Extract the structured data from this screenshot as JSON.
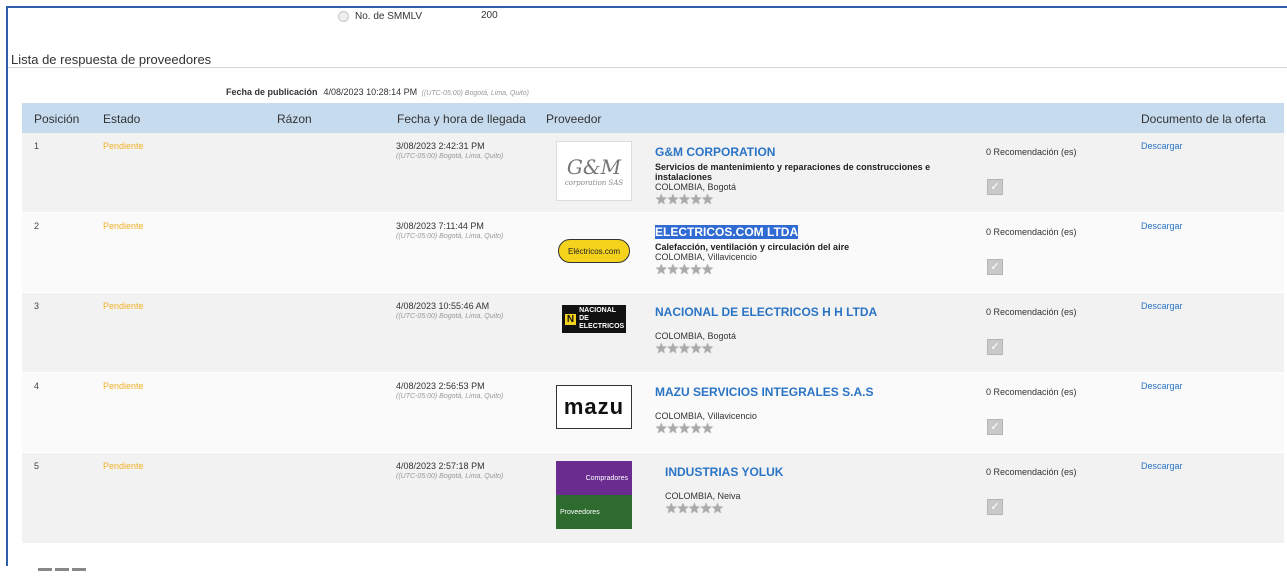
{
  "header": {
    "smmlv_label": "No. de SMMLV",
    "smmlv_value": "200",
    "section_title": "Lista de respuesta de proveedores",
    "pub_label": "Fecha de publicación",
    "pub_date": "4/08/2023 10:28:14 PM",
    "pub_tz": "((UTC-05:00) Bogotá, Lima, Quito)"
  },
  "columns": {
    "posicion": "Posición",
    "estado": "Estado",
    "razon": "Rázon",
    "fecha": "Fecha y hora de llegada",
    "proveedor": "Proveedor",
    "documento": "Documento de la oferta"
  },
  "rows": [
    {
      "pos": "1",
      "estado": "Pendiente",
      "fecha": "3/08/2023 2:42:31 PM",
      "tz": "((UTC-05:00) Bogotá, Lima, Quito)",
      "name": "G&M CORPORATION",
      "desc": "Servicios de mantenimiento y reparaciones de construcciones e instalaciones",
      "loc": "COLOMBIA, Bogotá",
      "rec": "0 Recomendación (es)",
      "download": "Descargar",
      "logo_text": "G&M",
      "logo_sub": "corporation SAS"
    },
    {
      "pos": "2",
      "estado": "Pendiente",
      "fecha": "3/08/2023 7:11:44 PM",
      "tz": "((UTC-05:00) Bogotá, Lima, Quito)",
      "name": "ELECTRICOS.COM LTDA",
      "desc": "Calefacción, ventilación y circulación del aire",
      "loc": "COLOMBIA, Villavicencio",
      "rec": "0 Recomendación (es)",
      "download": "Descargar",
      "logo_text": "Eléctricos.com"
    },
    {
      "pos": "3",
      "estado": "Pendiente",
      "fecha": "4/08/2023 10:55:46 AM",
      "tz": "((UTC-05:00) Bogotá, Lima, Quito)",
      "name": "NACIONAL DE ELECTRICOS H H LTDA",
      "desc": "",
      "loc": "COLOMBIA, Bogotá",
      "rec": "0 Recomendación (es)",
      "download": "Descargar",
      "logo_text": "NACIONAL DE ELECTRICOS"
    },
    {
      "pos": "4",
      "estado": "Pendiente",
      "fecha": "4/08/2023 2:56:53 PM",
      "tz": "((UTC-05:00) Bogotá, Lima, Quito)",
      "name": "MAZU SERVICIOS INTEGRALES S.A.S",
      "desc": "",
      "loc": "COLOMBIA, Villavicencio",
      "rec": "0 Recomendación (es)",
      "download": "Descargar",
      "logo_text": "mazu"
    },
    {
      "pos": "5",
      "estado": "Pendiente",
      "fecha": "4/08/2023 2:57:18 PM",
      "tz": "((UTC-05:00) Bogotá, Lima, Quito)",
      "name": "INDUSTRIAS YOLUK",
      "desc": "",
      "loc": "COLOMBIA, Neiva",
      "rec": "0 Recomendación (es)",
      "download": "Descargar",
      "logo_text": "Compradores",
      "logo_sub": "Proveedores"
    }
  ],
  "colors": {
    "accent": "#2a74c6",
    "header_bg": "#c7dbef",
    "pending": "#f0b22a",
    "frame": "#2e5fa8"
  }
}
